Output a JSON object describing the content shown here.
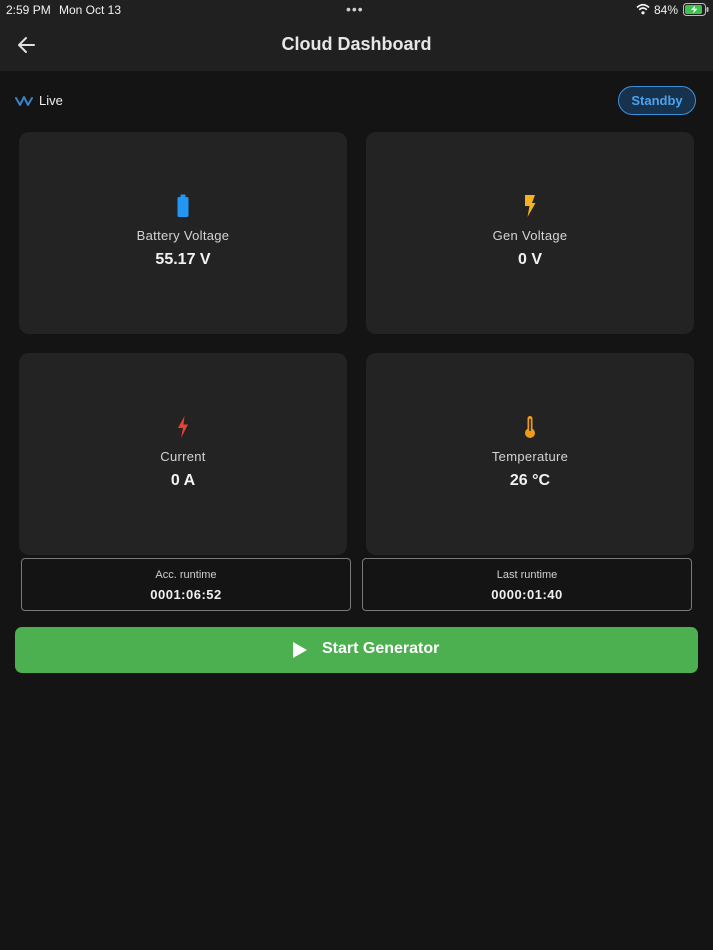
{
  "status_bar": {
    "time": "2:59 PM",
    "date": "Mon Oct 13",
    "battery_percent": "84%",
    "icons": [
      "wifi-icon",
      "battery-charging-icon"
    ]
  },
  "header": {
    "title": "Cloud Dashboard",
    "back_icon": "arrow-left-icon"
  },
  "live": {
    "label": "Live",
    "icon": "wave-icon",
    "color": "#3b82c4"
  },
  "standby": {
    "label": "Standby",
    "color": "#4aa3f0"
  },
  "metrics": [
    {
      "label": "Battery Voltage",
      "value": "55.17 V",
      "icon": "battery-icon",
      "color": "#2196f3"
    },
    {
      "label": "Gen Voltage",
      "value": "0 V",
      "icon": "bolt-icon",
      "color": "#f5b120"
    },
    {
      "label": "Current",
      "value": "0 A",
      "icon": "flash-icon",
      "color": "#e5432f"
    },
    {
      "label": "Temperature",
      "value": "26 °C",
      "icon": "thermometer-icon",
      "color": "#f09a1a"
    }
  ],
  "runtime": {
    "acc_label": "Acc. runtime",
    "acc_value": "0001:06:52",
    "last_label": "Last runtime",
    "last_value": "0000:01:40"
  },
  "action": {
    "label": "Start Generator",
    "icon": "play-icon",
    "color": "#4caf50"
  }
}
